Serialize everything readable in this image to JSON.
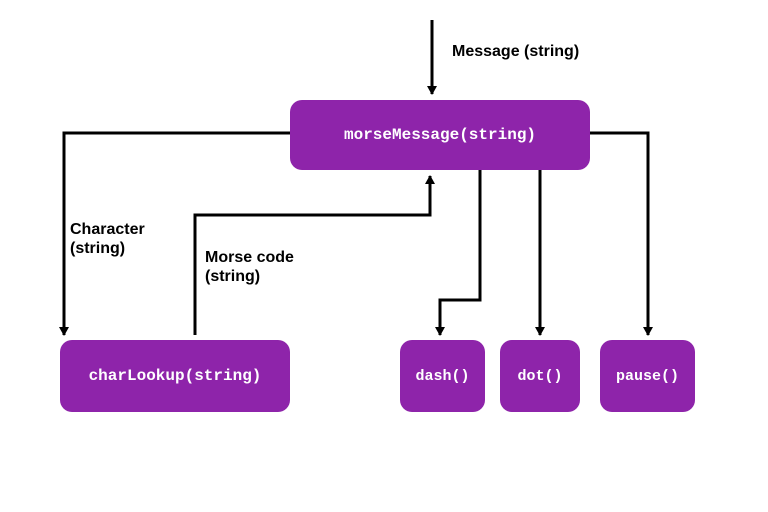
{
  "diagram": {
    "nodes": {
      "morseMessage": "morseMessage(string)",
      "charLookup": "charLookup(string)",
      "dash": "dash()",
      "dot": "dot()",
      "pause": "pause()"
    },
    "labels": {
      "message": "Message (string)",
      "character_l1": "Character",
      "character_l2": "(string)",
      "morsecode_l1": "Morse code",
      "morsecode_l2": "(string)"
    },
    "colors": {
      "node_bg": "#8e24aa",
      "node_fg": "#ffffff",
      "arrow": "#000000"
    }
  }
}
